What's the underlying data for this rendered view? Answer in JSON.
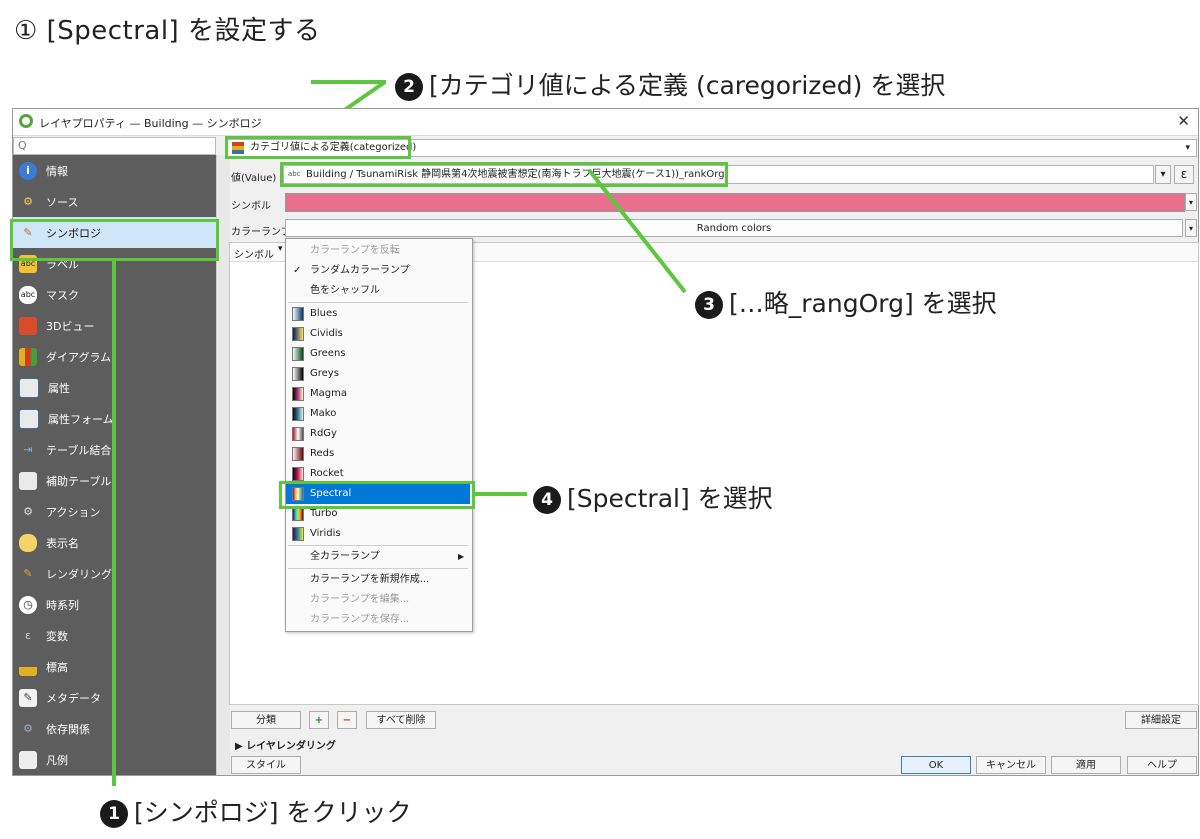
{
  "heading": "① [Spectral] を設定する",
  "callouts": {
    "c1": {
      "num": "1",
      "text": "[シンポロジ] をクリック"
    },
    "c2": {
      "num": "2",
      "text": "[カテゴリ値による定義 (caregorized) を選択"
    },
    "c3": {
      "num": "3",
      "text": "[…略_rangOrg] を選択"
    },
    "c4": {
      "num": "4",
      "text": "[Spectral] を選択"
    }
  },
  "window": {
    "title": "レイヤプロパティ — Building — シンボロジ",
    "close": "✕"
  },
  "search": {
    "placeholder": "Q"
  },
  "sidebar": {
    "items": [
      {
        "label": "情報",
        "icon": "info-icon"
      },
      {
        "label": "ソース",
        "icon": "source-icon"
      },
      {
        "label": "シンボロジ",
        "icon": "paintbrush-icon"
      },
      {
        "label": "ラベル",
        "icon": "label-icon"
      },
      {
        "label": "マスク",
        "icon": "mask-icon"
      },
      {
        "label": "3Dビュー",
        "icon": "cube-icon"
      },
      {
        "label": "ダイアグラム",
        "icon": "diagram-icon"
      },
      {
        "label": "属性",
        "icon": "table-icon"
      },
      {
        "label": "属性フォーム",
        "icon": "form-icon"
      },
      {
        "label": "テーブル結合",
        "icon": "join-icon"
      },
      {
        "label": "補助テーブル",
        "icon": "aux-table-icon"
      },
      {
        "label": "アクション",
        "icon": "gear-icon"
      },
      {
        "label": "表示名",
        "icon": "speech-bubble-icon"
      },
      {
        "label": "レンダリング",
        "icon": "brush-icon"
      },
      {
        "label": "時系列",
        "icon": "clock-icon"
      },
      {
        "label": "変数",
        "icon": "epsilon-icon"
      },
      {
        "label": "標高",
        "icon": "elevation-icon"
      },
      {
        "label": "メタデータ",
        "icon": "metadata-icon"
      },
      {
        "label": "依存関係",
        "icon": "dependency-icon"
      },
      {
        "label": "凡例",
        "icon": "legend-icon"
      }
    ]
  },
  "renderer": {
    "value": "カテゴリ値による定義(categorized)"
  },
  "value_row": {
    "label": "値(Value)",
    "type_tag": "abc",
    "value": "Building / TsunamiRisk 静岡県第4次地震被害想定(南海トラフ巨大地震(ケース1))_rankOrg",
    "expr_button": "ε"
  },
  "symbol_row": {
    "label": "シンボル",
    "color": "#e8708e"
  },
  "colorramp_row": {
    "label": "カラーランプ",
    "value": "Random colors"
  },
  "columns": {
    "symbol": "シンボル"
  },
  "menu": {
    "invert": "カラーランプを反転",
    "random": "ランダムカラーランプ",
    "shuffle": "色をシャッフル",
    "ramps": [
      {
        "name": "Blues"
      },
      {
        "name": "Cividis"
      },
      {
        "name": "Greens"
      },
      {
        "name": "Greys"
      },
      {
        "name": "Magma"
      },
      {
        "name": "Mako"
      },
      {
        "name": "RdGy"
      },
      {
        "name": "Reds"
      },
      {
        "name": "Rocket"
      },
      {
        "name": "Spectral"
      },
      {
        "name": "Turbo"
      },
      {
        "name": "Viridis"
      }
    ],
    "all": "全カラーランプ",
    "create": "カラーランプを新規作成...",
    "edit": "カラーランプを編集...",
    "save": "カラーランプを保存..."
  },
  "bottom": {
    "classify": "分類",
    "add": "+",
    "remove": "−",
    "delete_all": "すべて削除",
    "advanced": "詳細設定",
    "layer_rendering": "レイヤレンダリング",
    "style": "スタイル",
    "ok": "OK",
    "cancel": "キャンセル",
    "apply": "適用",
    "help": "ヘルプ"
  },
  "colors": {
    "accent_green": "#5cc63f",
    "highlight": "#0078d7",
    "sidebar_bg": "#5d5d5d"
  }
}
